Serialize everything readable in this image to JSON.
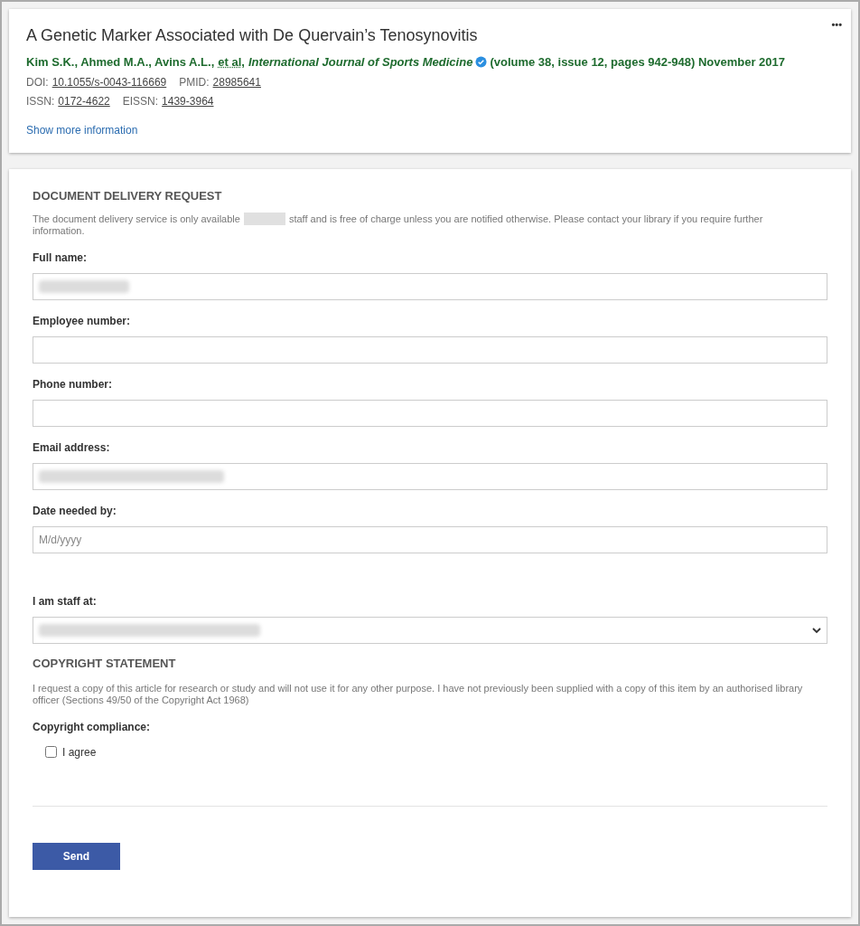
{
  "article": {
    "title": "A Genetic Marker Associated with De Quervain’s Tenosynovitis",
    "authors": "Kim S.K., Ahmed M.A., Avins A.L.,",
    "et_al": "et al",
    "et_al_suffix": ",",
    "journal": "International Journal of Sports Medicine",
    "journal_verified": true,
    "details": "(volume 38, issue 12, pages 942-948) November 2017",
    "identifiers": [
      [
        {
          "label": "DOI:",
          "value": "10.1055/s-0043-116669"
        },
        {
          "label": "PMID:",
          "value": "28985641"
        }
      ],
      [
        {
          "label": "ISSN:",
          "value": "0172-4622"
        },
        {
          "label": "EISSN:",
          "value": "1439-3964"
        }
      ]
    ],
    "more_link": "Show more information",
    "menu": "•••"
  },
  "form": {
    "heading": "DOCUMENT DELIVERY REQUEST",
    "intro_before": "The document delivery service is only available",
    "intro_redacted": true,
    "intro_after": "staff and is free of charge unless you are notified otherwise. Please contact your library if you require further",
    "intro_end": "information.",
    "fields": [
      {
        "kind": "text",
        "label": "Full name:",
        "redacted": true
      },
      {
        "kind": "text",
        "label": "Employee number:",
        "redacted": false
      },
      {
        "kind": "text",
        "label": "Phone number:",
        "redacted": false
      },
      {
        "kind": "text",
        "label": "Email address:",
        "redacted": true
      },
      {
        "kind": "date",
        "label": "Date needed by:",
        "placeholder": "M/d/yyyy",
        "redacted": false
      },
      {
        "kind": "select",
        "label": "I am staff at:",
        "redacted": true
      }
    ],
    "copyright_heading": "COPYRIGHT STATEMENT",
    "copyright_text": "I request a copy of this article for research or study and will not use it for any other purpose. I have not previously been supplied with a copy of this item by an authorised library officer (Sections 49/50 of the Copyright Act 1968)",
    "compliance_label": "Copyright compliance:",
    "agree": {
      "label": "I agree",
      "checked": false
    },
    "send": "Send"
  }
}
